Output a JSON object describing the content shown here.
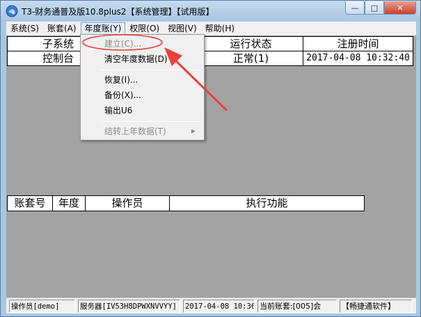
{
  "window": {
    "title": "T3-财务通普及版10.8plus2【系统管理】【试用版】",
    "controls": {
      "minimize": "—",
      "maximize": "□",
      "close": "✕"
    }
  },
  "menubar": {
    "items": [
      {
        "label": "系统(S)"
      },
      {
        "label": "账套(A)"
      },
      {
        "label": "年度账(Y)"
      },
      {
        "label": "权限(O)"
      },
      {
        "label": "视图(V)"
      },
      {
        "label": "帮助(H)"
      }
    ]
  },
  "dropdown": {
    "items": [
      {
        "label": "建立(C)...",
        "disabled": true
      },
      {
        "label": "清空年度数据(D)",
        "disabled": false
      },
      {
        "label": "恢复(I)...",
        "disabled": false
      },
      {
        "label": "备份(X)...",
        "disabled": false
      },
      {
        "label": "输出U6",
        "disabled": false
      },
      {
        "label": "结转上年数据(T)",
        "disabled": true,
        "submenu": "▶"
      }
    ]
  },
  "upper_table": {
    "headers": [
      "子系统",
      "运行状态",
      "注册时间"
    ],
    "rows": [
      [
        "控制台",
        "正常(1)",
        "2017-04-08 10:32:40"
      ]
    ]
  },
  "lower_table": {
    "headers": [
      "账套号",
      "年度",
      "操作员",
      "执行功能"
    ]
  },
  "statusbar": {
    "operator": "操作员[demo]",
    "server": "服务器[IV53H8DPWXNVVYY]",
    "datetime": "2017-04-08 10:36",
    "current_account": "当前账套:[005]会",
    "vendor": "【畅捷通软件】"
  },
  "colors": {
    "workspace": "#a3a3a3",
    "annotation": "#e8413c"
  },
  "icons": [
    "app-logo-icon",
    "minimize-icon",
    "maximize-icon",
    "close-icon",
    "submenu-arrow-icon"
  ]
}
